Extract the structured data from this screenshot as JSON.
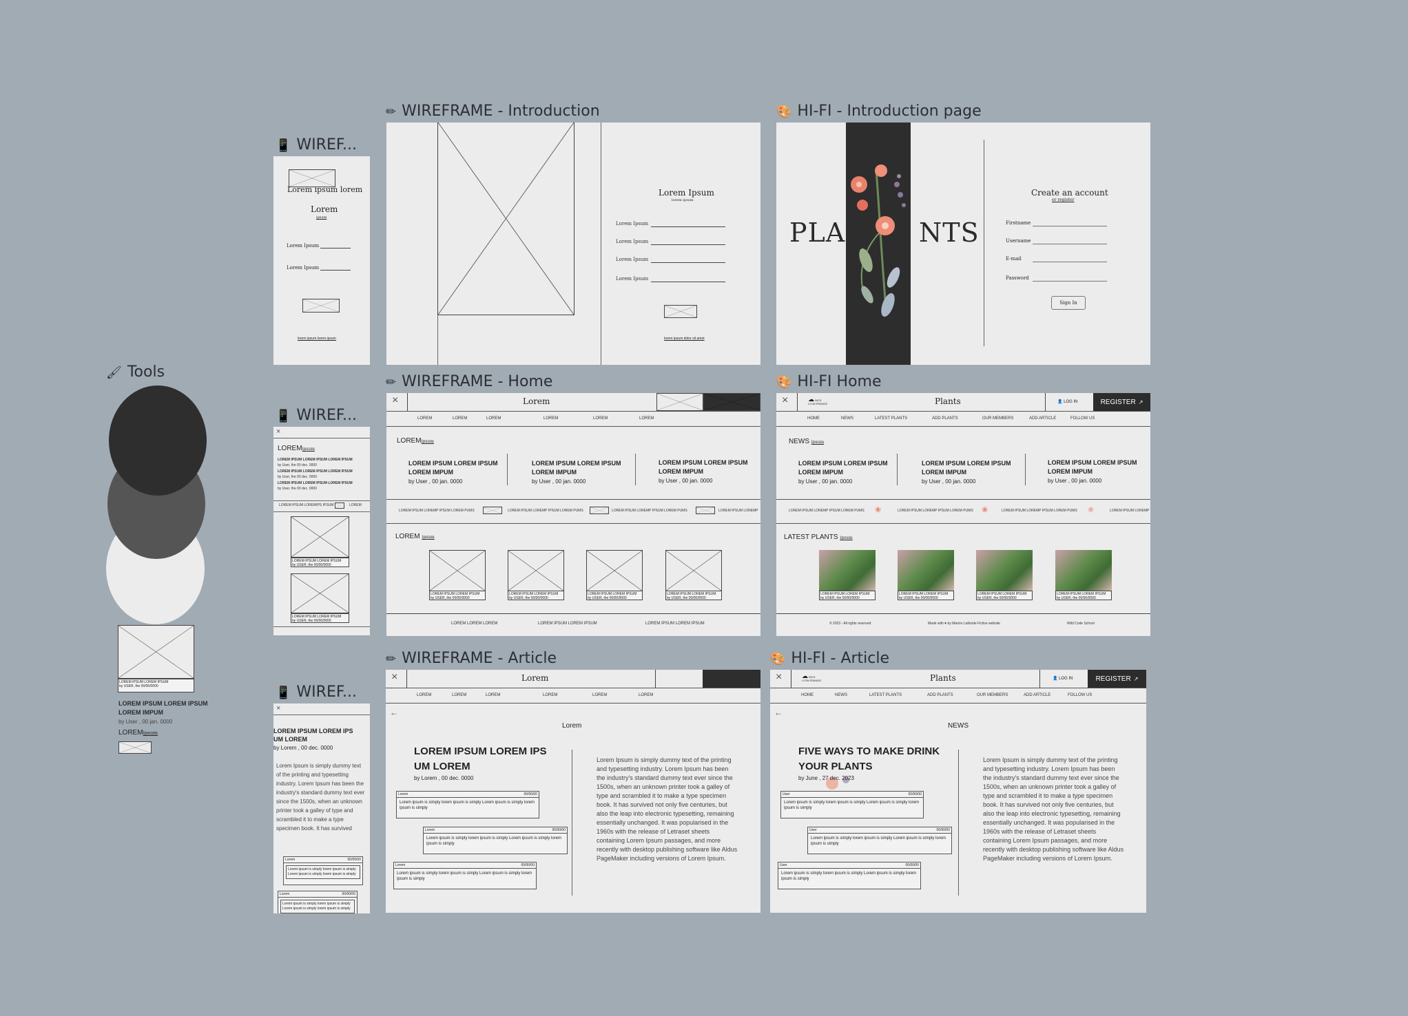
{
  "frames": {
    "wf_intro": "WIREFRAME - Introduction",
    "hifi_intro": "HI-FI - Introduction page",
    "wf_home": "WIREFRAME - Home",
    "hifi_home": "HI-FI Home",
    "wf_article": "WIREFRAME - Article",
    "hifi_article": "HI-FI - Article",
    "mobile1": "WIREF...",
    "mobile2": "WIREF...",
    "mobile3": "WIREF...",
    "tools": "Tools"
  },
  "tools": {
    "card_label_1": "LOREM IPSUM LOREM IPSUM",
    "card_label_2": "by USER, the 00/00/0000",
    "heading_1": "LOREM IPSUM LOREM IPSUM",
    "heading_2": "LOREM IMPUM",
    "byline": "by User , 00 jan. 0000",
    "lorem": "LOREM",
    "ipsum": "ipsum",
    "colors": [
      "#2e2e2e",
      "#555555",
      "#ececec"
    ]
  },
  "mobile_intro": {
    "title": "Lorem ipsum lorem",
    "sub": "Lorem",
    "subsub": "ipsum",
    "field1": "Lorem Ipsum",
    "field2": "Lorem Ipsum",
    "link": "lorem ipsum lorem ipsum"
  },
  "wf_intro": {
    "title": "Lorem Ipsum",
    "subtitle": "lorem ipsum",
    "fields": [
      "Lorem Ipsum",
      "Lorem Ipsum",
      "Lorem Ipsum",
      "Lorem Ipsum"
    ],
    "link": "lorem ipsum dolor sit amet"
  },
  "hifi_intro": {
    "brand_left": "PLA",
    "brand_right": "NTS",
    "title": "Create an account",
    "subtitle": "or register",
    "fields": [
      "Firstname",
      "Username",
      "E-mail",
      "Password"
    ],
    "button": "Sign In"
  },
  "wf_home": {
    "nav_title": "Lorem",
    "menu": [
      "LOREM",
      "LOREM",
      "LOREM",
      "LOREM",
      "LOREM",
      "LOREM"
    ],
    "news_label": "LOREM",
    "news_sub": "ipsum",
    "news": [
      {
        "t1": "LOREM IPSUM LOREM IPSUM",
        "t2": "LOREM IMPUM",
        "by": "by User , 00 jan. 0000"
      },
      {
        "t1": "LOREM IPSUM LOREM IPSUM",
        "t2": "LOREM IMPUM",
        "by": "by User , 00 jan. 0000"
      },
      {
        "t1": "LOREM IPSUM LOREM IPSUM",
        "t2": "LOREM IMPUM",
        "by": "by User , 00 jan. 0000"
      }
    ],
    "ticker": [
      "LOREM IPSUM LOREMP IPSUM LOREM PUMS",
      "LOREM IPSUM LOREMP IPSUM LOREM PUMS",
      "LOREM IPSUM LOREMP IPSUM LOREM PUMS",
      "LOREM IPSUM LOREMP"
    ],
    "latest_label": "LOREM",
    "latest_sub": "ipsum",
    "cards": [
      {
        "l1": "LOREM IPSUM LOREM IPSUM",
        "l2": "by USER, the 00/00/0000"
      },
      {
        "l1": "LOREM IPSUM LOREM IPSUM",
        "l2": "by USER, the 00/00/0000"
      },
      {
        "l1": "LOREM IPSUM LOREM IPSUM",
        "l2": "by USER, the 00/00/0000"
      },
      {
        "l1": "LOREM IPSUM LOREM IPSUM",
        "l2": "by USER, the 00/00/0000"
      }
    ],
    "footer": [
      "LOREM LOREM LOREM",
      "LOREM IPSUM LOREM IPSUM",
      "LOREM IPSUM LOREM IPSUM"
    ]
  },
  "hifi_home": {
    "nav_title": "Plants",
    "login": "LOG IN",
    "register": "REGISTER",
    "logo": "WCS LYON FRANCE",
    "menu": [
      "HOME",
      "NEWS",
      "LATEST PLANTS",
      "ADD PLANTS",
      "OUR MEMBERS",
      "ADD ARTICLE",
      "FOLLOW US"
    ],
    "news_label": "NEWS",
    "news_sub": "ipsum",
    "news": [
      {
        "t1": "LOREM IPSUM LOREM IPSUM",
        "t2": "LOREM IMPUM",
        "by": "by User , 00 jan. 0000"
      },
      {
        "t1": "LOREM IPSUM LOREM IPSUM",
        "t2": "LOREM IMPUM",
        "by": "by User , 00 jan. 0000"
      },
      {
        "t1": "LOREM IPSUM LOREM IPSUM",
        "t2": "LOREM IMPUM",
        "by": "by User , 00 jan. 0000"
      }
    ],
    "ticker": [
      "LOREM IPSUM LOREMP IPSUM LOREM PUMS",
      "LOREM IPSUM LOREMP IPSUM LOREM PUMS",
      "LOREM IPSUM LOREMP IPSUM LOREM PUMS",
      "LOREM IPSUM LOREMP"
    ],
    "latest_label": "LATEST PLANTS",
    "latest_sub": "ipsum",
    "cards": [
      {
        "l1": "LOREM IPSUM LOREM IPSUM",
        "l2": "by USER, the 00/00/0000"
      },
      {
        "l1": "LOREM IPSUM LOREM IPSUM",
        "l2": "by USER, the 00/00/0000"
      },
      {
        "l1": "LOREM IPSUM LOREM IPSUM",
        "l2": "by USER, the 00/00/0000"
      },
      {
        "l1": "LOREM IPSUM LOREM IPSUM",
        "l2": "by USER, the 00/00/0000"
      }
    ],
    "footer": [
      "© 2023 - All rights reserved",
      "Made with ♥ by Marion Lallonde Fictive website",
      "Wild Code School"
    ]
  },
  "mobile_home": {
    "label": "LOREM",
    "sub": "ipsum",
    "items": [
      {
        "t": "LOREM IPSUM LOREM IPSUM LOREM IPSUM",
        "by": "by User, the 00 dec. 0000"
      },
      {
        "t": "LOREM IPSUM LOREM IPSUM LOREM IPSUM",
        "by": "by User, the 00 dec. 0000"
      },
      {
        "t": "LOREM IPSUM LOREM IPSUM LOREM IPSUM",
        "by": "by User, the 00 dec. 0000"
      }
    ],
    "ticker": "LOREM IPSUM LOREMIPS IPSUM",
    "ticker2": "LOREM",
    "cards": [
      {
        "l1": "LOREM IPSUM LOREM IPSUM",
        "l2": "by USER, the 00/00/0000"
      },
      {
        "l1": "LOREM IPSUM LOREM IPSUM",
        "l2": "by USER, the 00/00/0000"
      }
    ]
  },
  "wf_article": {
    "nav_title": "Lorem",
    "menu": [
      "LOREM",
      "LOREM",
      "LOREM",
      "LOREM",
      "LOREM",
      "LOREM"
    ],
    "section": "Lorem",
    "headline1": "LOREM IPSUM LOREM IPS",
    "headline2": "UM LOREM",
    "byline": "by Lorem , 00 dec. 0000",
    "comments": [
      {
        "u": "Lorem",
        "d": "00/00/00",
        "t": "Lorem ipsum is simply lorem ipsum is simply Lorem ipsum is simply lorem ipsum is simply"
      },
      {
        "u": "Lorem",
        "d": "00/00/00",
        "t": "Lorem ipsum is simply lorem ipsum is simply Lorem ipsum is simply lorem ipsum is simply"
      },
      {
        "u": "Lorem",
        "d": "00/00/00",
        "t": "Lorem ipsum is simply lorem ipsum is simply Lorem ipsum is simply lorem ipsum is simply"
      }
    ],
    "body": "Lorem Ipsum is simply dummy text of the printing and typesetting industry. Lorem Ipsum has been the industry's standard dummy text ever since the 1500s, when an unknown printer took a galley of type and scrambled it to make a type specimen book. It has survived not only five centuries, but also the leap into electronic typesetting, remaining essentially unchanged. It was popularised in the 1960s with the release of Letraset sheets containing Lorem Ipsum passages, and more recently with desktop publishing software like Aldus PageMaker including versions of Lorem Ipsum."
  },
  "hifi_article": {
    "nav_title": "Plants",
    "login": "LOG IN",
    "register": "REGISTER",
    "logo": "WCS LYON FRANCE",
    "menu": [
      "HOME",
      "NEWS",
      "LATEST PLANTS",
      "ADD PLANTS",
      "OUR MEMBERS",
      "ADD ARTICLE",
      "FOLLOW US"
    ],
    "section": "NEWS",
    "headline1": "FIVE WAYS TO MAKE DRINK",
    "headline2": "YOUR PLANTS",
    "byline": "by June , 27 dec. 2023",
    "comments": [
      {
        "u": "User",
        "d": "00/00/00",
        "t": "Lorem ipsum is simply lorem ipsum is simply Lorem ipsum is simply lorem ipsum is simply"
      },
      {
        "u": "User",
        "d": "00/00/00",
        "t": "Lorem ipsum is simply lorem ipsum is simply Lorem ipsum is simply lorem ipsum is simply"
      },
      {
        "u": "User",
        "d": "00/00/00",
        "t": "Lorem ipsum is simply lorem ipsum is simply Lorem ipsum is simply lorem ipsum is simply"
      }
    ],
    "body": "Lorem Ipsum is simply dummy text of the printing and typesetting industry. Lorem Ipsum has been the industry's standard dummy text ever since the 1500s, when an unknown printer took a galley of type and scrambled it to make a type specimen book. It has survived not only five centuries, but also the leap into electronic typesetting, remaining essentially unchanged. It was popularised in the 1960s with the release of Letraset sheets containing Lorem Ipsum passages, and more recently with desktop publishing software like Aldus PageMaker including versions of Lorem Ipsum."
  },
  "mobile_article": {
    "headline1": "LOREM IPSUM LOREM IPS",
    "headline2": "UM LOREM",
    "byline": "by Lorem , 00 dec. 0000",
    "body": "Lorem Ipsum is simply dummy text of the printing and typesetting industry. Lorem Ipsum has been the industry's standard dummy text ever since the 1500s, when an unknown printer took a galley of type and scrambled it to make a type specimen book. It has survived",
    "comments": [
      {
        "u": "Lorem",
        "d": "00/00/00",
        "t": "Lorem ipsum is simply lorem ipsum is simply Lorem ipsum is simply lorem ipsum is simply"
      },
      {
        "u": "Lorem",
        "d": "00/00/00",
        "t": "Lorem ipsum is simply lorem ipsum is simply Lorem ipsum is simply lorem ipsum is simply"
      }
    ]
  }
}
